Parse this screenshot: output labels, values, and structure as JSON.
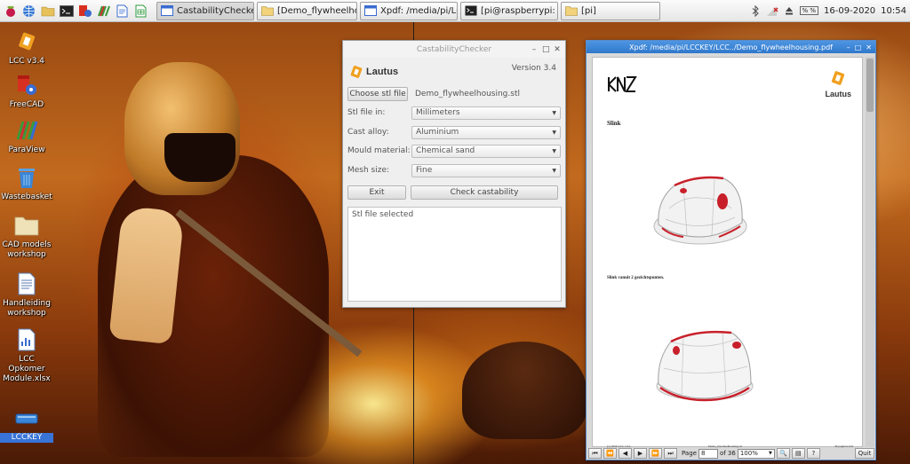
{
  "taskbar": {
    "tasks": [
      {
        "label": "CastabilityChecker"
      },
      {
        "label": "[Demo_flywheelhous..."
      },
      {
        "label": "Xpdf: /media/pi/LCC..."
      },
      {
        "label": "[pi@raspberrypi: ~]"
      },
      {
        "label": "[pi]"
      }
    ],
    "tray": {
      "volume_pct": "% %",
      "date": "16-09-2020",
      "time": "10:54"
    }
  },
  "desktop_icons": [
    {
      "label": "LCC v3.4"
    },
    {
      "label": "FreeCAD"
    },
    {
      "label": "ParaView"
    },
    {
      "label": "Wastebasket"
    },
    {
      "label": "CAD models workshop"
    },
    {
      "label": "Handleiding workshop"
    },
    {
      "label": "LCC Opkomer Module.xlsx"
    },
    {
      "label": "LCCKEY"
    }
  ],
  "castability": {
    "title": "CastabilityChecker",
    "logo_text": "Lautus",
    "version": "Version 3.4",
    "choose_button": "Choose stl file",
    "file_name": "Demo_flywheelhousing.stl",
    "fields": [
      {
        "label": "Stl file in:",
        "value": "Millimeters"
      },
      {
        "label": "Cast alloy:",
        "value": "Aluminium"
      },
      {
        "label": "Mould material:",
        "value": "Chemical sand"
      },
      {
        "label": "Mesh size:",
        "value": "Fine"
      }
    ],
    "exit_button": "Exit",
    "check_button": "Check castability",
    "log_text": "Stl file selected"
  },
  "xpdf": {
    "title": "Xpdf: /media/pi/LCCKEY/LCC../Demo_flywheelhousing.pdf",
    "page_logo_text": "Lautus",
    "heading1": "Slink",
    "heading2": "Slink vanuit 2 gezichtspunten.",
    "footer_left": "(c) 2020 LCC v3.4",
    "footer_center": "Demo_flywheelhousing.stl",
    "footer_right": "36 pagina's 6/6",
    "toolbar": {
      "page_label": "Page",
      "page_value": "8",
      "page_total": "of 36",
      "zoom_value": "100%",
      "quit_label": "Quit"
    }
  },
  "colors": {
    "accent_blue": "#3874d8",
    "lautus_orange": "#f0a020",
    "defect_red": "#c8202a"
  }
}
